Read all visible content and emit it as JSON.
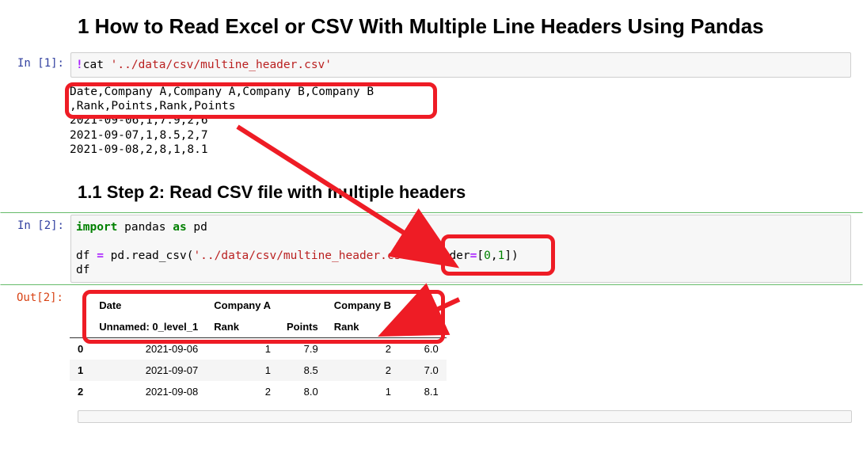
{
  "h1": "1  How to Read Excel or CSV With Multiple Line Headers Using Pandas",
  "h2": "1.1  Step 2: Read CSV file with multiple headers",
  "cell1": {
    "prompt": "In [1]:",
    "bang": "!",
    "cmd": "cat ",
    "path": "'../data/csv/multine_header.csv'",
    "out_lines": [
      "Date,Company A,Company A,Company B,Company B",
      ",Rank,Points,Rank,Points",
      "2021-09-06,1,7.9,2,6",
      "2021-09-07,1,8.5,2,7",
      "2021-09-08,2,8,1,8.1"
    ]
  },
  "cell2": {
    "prompt": "In [2]:",
    "kw_import": "import",
    "mod": " pandas ",
    "kw_as": "as",
    "alias": " pd",
    "line2_pre": "df ",
    "eq": "=",
    "line2_mid": " pd.read_csv(",
    "arg_path": "'../data/csv/multine_header.csv'",
    "comma": ", ",
    "kw_header": "header",
    "eq2": "=",
    "br_open": "[",
    "n0": "0",
    "c": ",",
    "n1": "1",
    "br_close": "])",
    "line3": "df",
    "out_prompt": "Out[2]:"
  },
  "table": {
    "head_row1": [
      "",
      "Date",
      "Company A",
      "",
      "Company B",
      ""
    ],
    "head_row2": [
      "",
      "Unnamed: 0_level_1",
      "Rank",
      "Points",
      "Rank",
      "Points"
    ],
    "rows": [
      [
        "0",
        "2021-09-06",
        "1",
        "7.9",
        "2",
        "6.0"
      ],
      [
        "1",
        "2021-09-07",
        "1",
        "8.5",
        "2",
        "7.0"
      ],
      [
        "2",
        "2021-09-08",
        "2",
        "8.0",
        "1",
        "8.1"
      ]
    ]
  }
}
